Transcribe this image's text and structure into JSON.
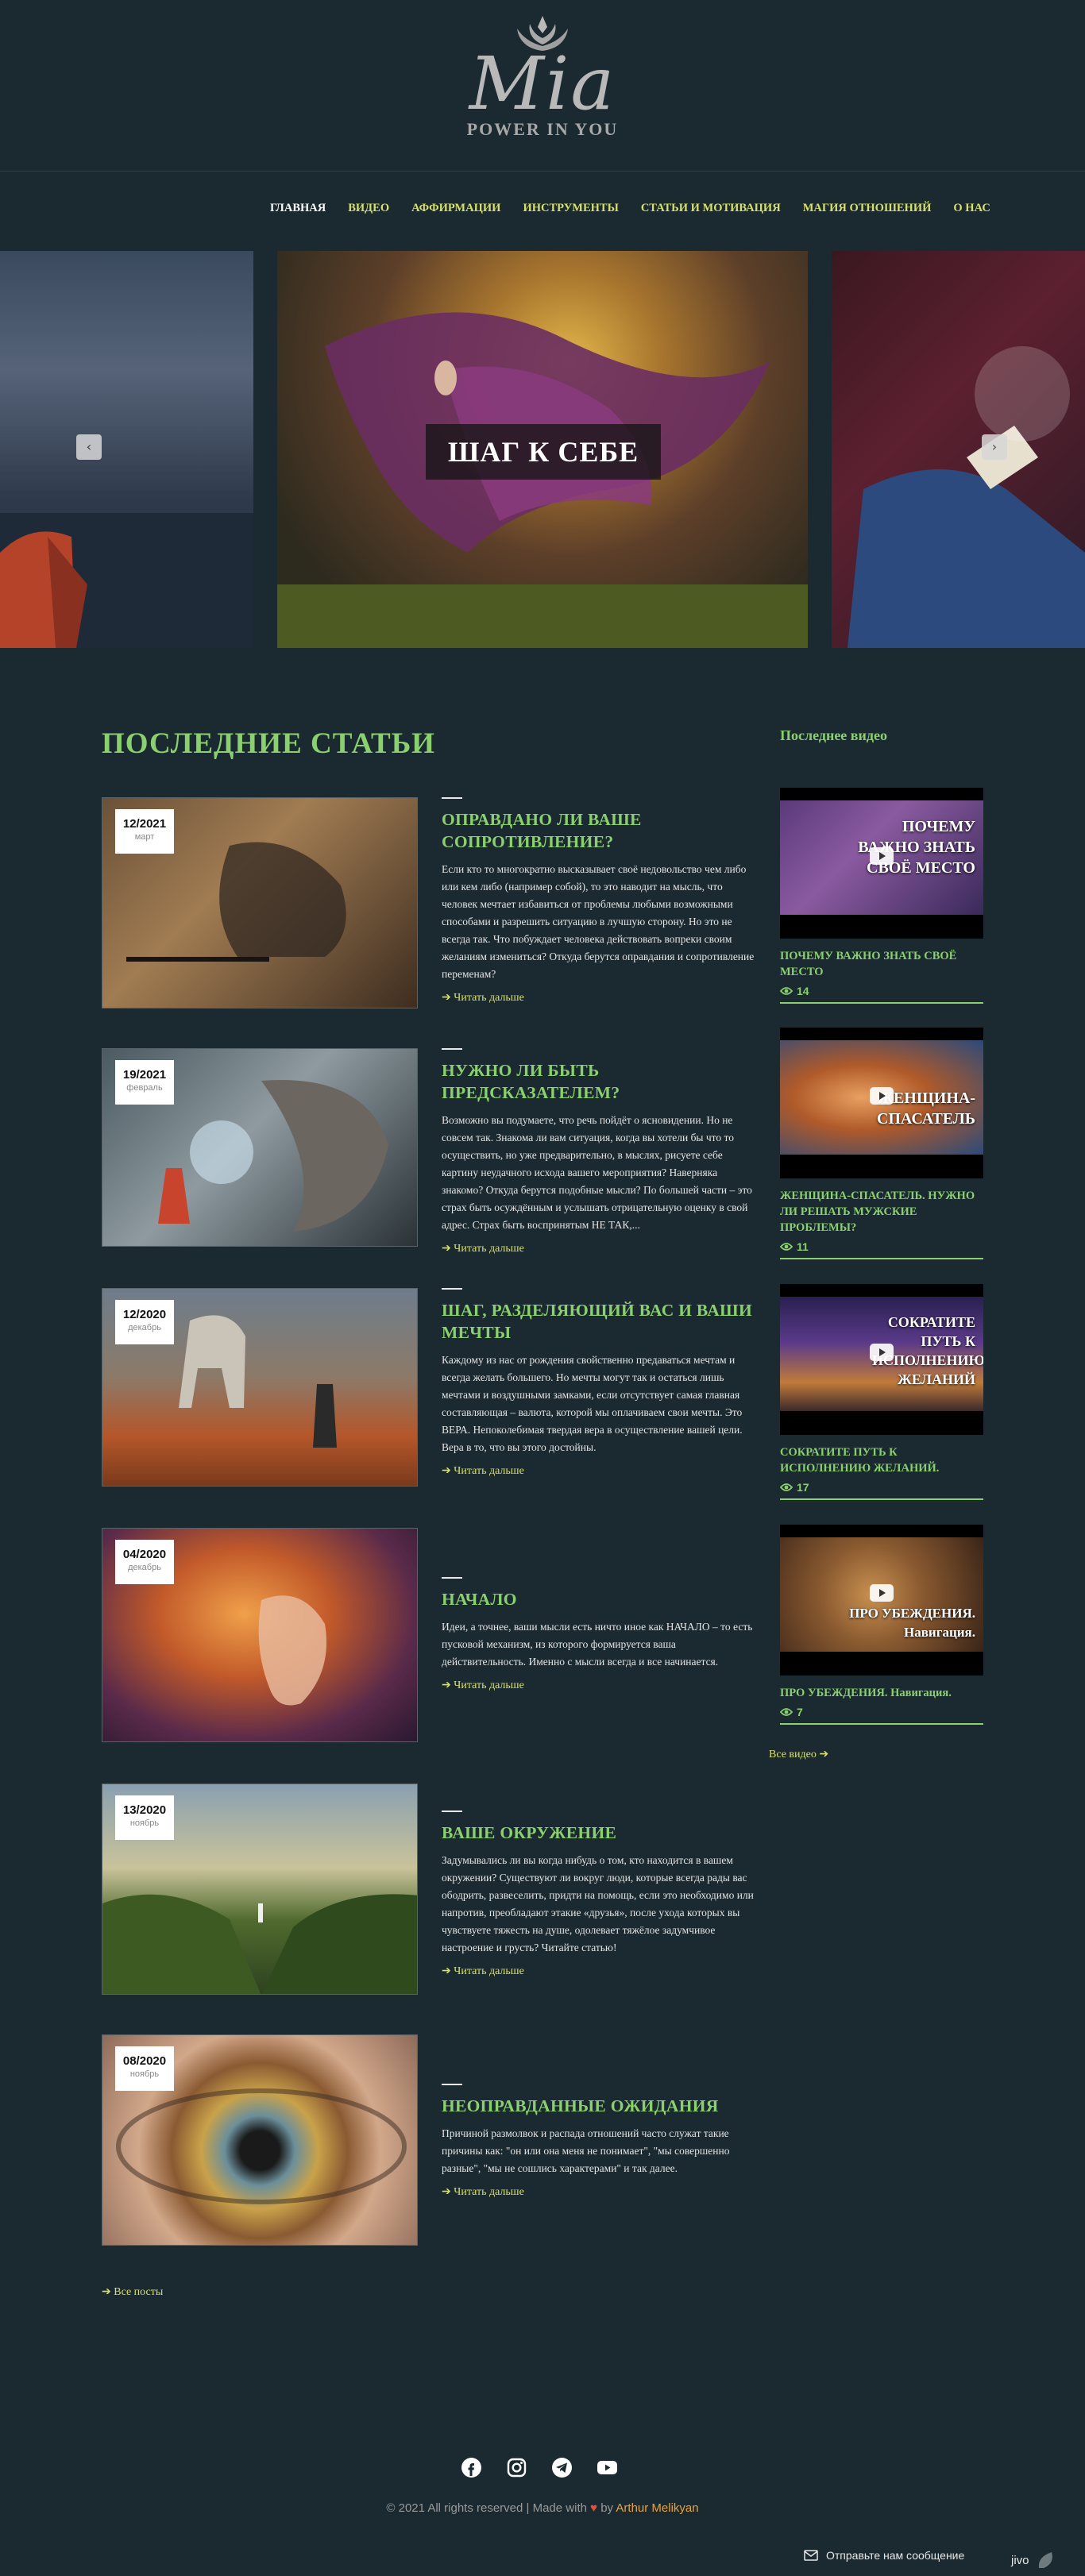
{
  "brand": {
    "name": "Mia",
    "tagline": "POWER IN YOU"
  },
  "nav": [
    {
      "label": "ГЛАВНАЯ"
    },
    {
      "label": "ВИДЕО"
    },
    {
      "label": "АФФИРМАЦИИ"
    },
    {
      "label": "ИНСТРУМЕНТЫ"
    },
    {
      "label": "СТАТЬИ И МОТИВАЦИЯ"
    },
    {
      "label": "МАГИЯ ОТНОШЕНИЙ"
    },
    {
      "label": "О НАС"
    }
  ],
  "slider": {
    "title": "ШАГ К СЕБЕ",
    "prev_icon": "chevron-left-icon",
    "next_icon": "chevron-right-icon"
  },
  "articles": {
    "heading": "ПОСЛЕДНИЕ СТАТЬИ",
    "read_more": "Читать дальше",
    "all_posts": "Все посты",
    "items": [
      {
        "date": "12/2021",
        "month": "март",
        "title": "ОПРАВДАНО ЛИ ВАШЕ СОПРОТИВЛЕНИЕ?",
        "excerpt": "Если кто то многократно высказывает своё недовольство чем либо или кем либо (например собой), то это наводит на мысль, что человек мечтает избавиться от проблемы любыми возможными способами и разрешить ситуацию в лучшую сторону. Но это не всегда так. Что побуждает человека действовать вопреки своим желаниям измениться? Откуда берутся оправдания и сопротивление переменам?"
      },
      {
        "date": "19/2021",
        "month": "февраль",
        "title": "НУЖНО ЛИ БЫТЬ ПРЕДСКАЗАТЕЛЕМ?",
        "excerpt": "Возможно вы подумаете, что речь пойдёт о ясновидении. Но не совсем так. Знакома ли вам ситуация, когда вы хотели бы что то осуществить, но уже предварительно, в мыслях, рисуете себе картину неудачного исхода вашего мероприятия? Наверняка знакомо? Откуда берутся подобные мысли? По большей части – это страх быть осуждённым и услышать отрицательную оценку в свой адрес. Страх быть воспринятым НЕ ТАК,..."
      },
      {
        "date": "12/2020",
        "month": "декабрь",
        "title": "ШАГ, РАЗДЕЛЯЮЩИЙ ВАС И ВАШИ МЕЧТЫ",
        "excerpt": "Каждому из нас от рождения свойственно предаваться мечтам и всегда желать большего. Но мечты могут так и остаться лишь мечтами и воздушными замками, если отсутствует самая главная составляющая – валюта, которой мы оплачиваем свои мечты. Это ВЕРА. Непоколебимая твердая вера в осуществление вашей цели. Вера в то, что вы этого достойны."
      },
      {
        "date": "04/2020",
        "month": "декабрь",
        "title": "НАЧАЛО",
        "excerpt": "Идеи, а точнее, ваши мысли есть ничто иное как НАЧАЛО – то есть пусковой механизм, из которого формируется ваша действительность. Именно с мысли всегда и все начинается."
      },
      {
        "date": "13/2020",
        "month": "ноябрь",
        "title": "ВАШЕ ОКРУЖЕНИЕ",
        "excerpt": "Задумывались ли вы когда нибудь о том, кто находится в вашем окружении? Существуют ли вокруг люди, которые всегда рады вас ободрить, развеселить, придти на помощь, если это необходимо или напротив, преобладают этакие «друзья», после ухода которых вы чувствуете тяжесть на душе, одолевает тяжёлое задумчивое настроение и грусть? Читайте статью!"
      },
      {
        "date": "08/2020",
        "month": "ноябрь",
        "title": "НЕОПРАВДАННЫЕ ОЖИДАНИЯ",
        "excerpt": "Причиной размолвок и распада отношений часто служат такие причины как: \"он или она меня не понимает\", \"мы совершенно разные\", \"мы не сошлись характерами\" и так далее."
      }
    ]
  },
  "videos": {
    "heading": "Последнее видео",
    "all_videos": "Все видео",
    "items": [
      {
        "caption": "ПОЧЕМУ ВАЖНО ЗНАТЬ СВОЁ МЕСТО",
        "title": "ПОЧЕМУ ВАЖНО ЗНАТЬ СВОЁ МЕСТО",
        "views": "14"
      },
      {
        "caption": "ЖЕНЩИНА- СПАСАТЕЛЬ",
        "title": "ЖЕНЩИНА-СПАСАТЕЛЬ. НУЖНО ЛИ РЕШАТЬ МУЖСКИЕ ПРОБЛЕМЫ?",
        "views": "11"
      },
      {
        "caption": "СОКРАТИТЕ ПУТЬ К ИСПОЛНЕНИЮ ЖЕЛАНИЙ",
        "title": "СОКРАТИТЕ ПУТЬ К ИСПОЛНЕНИЮ ЖЕЛАНИЙ.",
        "views": "17"
      },
      {
        "caption": "ПРО УБЕЖДЕНИЯ. Навигация.",
        "title": "ПРО УБЕЖДЕНИЯ. Навигация.",
        "views": "7"
      }
    ]
  },
  "footer": {
    "social": [
      "facebook-icon",
      "instagram-icon",
      "telegram-icon",
      "youtube-icon"
    ],
    "copyright_prefix": "© 2021 All rights reserved | Made with",
    "copyright_by": "by",
    "author": "Arthur Melikyan",
    "chat_label": "Отправьте нам сообщение",
    "chat_brand": "jivo"
  },
  "colors": {
    "background": "#1a2a30",
    "accent_green": "#8bd06e",
    "accent_yellow": "#d9e06a",
    "author_orange": "#e9a23b"
  }
}
